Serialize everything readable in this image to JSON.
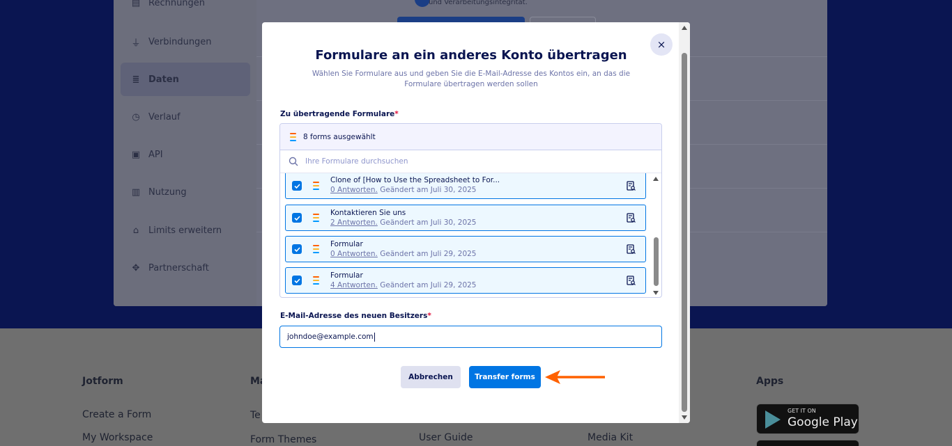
{
  "background": {
    "sidebar": {
      "items": [
        {
          "label": "Rechnungen",
          "icon": "invoice-icon",
          "active": false
        },
        {
          "label": "Verbindungen",
          "icon": "plug-icon",
          "active": false
        },
        {
          "label": "Daten",
          "icon": "database-icon",
          "active": true
        },
        {
          "label": "Verlauf",
          "icon": "history-icon",
          "active": false
        },
        {
          "label": "API",
          "icon": "api-icon",
          "active": false
        },
        {
          "label": "Nutzung",
          "icon": "bar-chart-icon",
          "active": false
        },
        {
          "label": "Limits erweitern",
          "icon": "gift-icon",
          "active": false
        },
        {
          "label": "Partnerschaft",
          "icon": "handshake-icon",
          "active": false
        }
      ]
    },
    "main": {
      "top_text": "und Verarbeitungsintegrität."
    },
    "footer": {
      "col1": {
        "heading": "Jotform",
        "links": [
          "Create a Form",
          "My Workspace"
        ]
      },
      "col2": {
        "heading": "Ma",
        "links": [
          "Te",
          "Form Themes"
        ]
      },
      "col3": {
        "links": [
          "User Guide"
        ]
      },
      "col4": {
        "links": [
          "Media Kit"
        ]
      },
      "apps": {
        "heading": "Apps",
        "badge_small": "GET IT ON",
        "badge_big": "Google Play"
      }
    }
  },
  "modal": {
    "title": "Formulare an ein anderes Konto übertragen",
    "subtitle": "Wählen Sie Formulare aus und geben Sie die E-Mail-Adresse des Kontos ein, an das die Formulare übertragen werden sollen",
    "forms_label": "Zu übertragende Formulare",
    "required_mark": "*",
    "selected_count": "8 forms ausgewählt",
    "search_placeholder": "Ihre Formulare durchsuchen",
    "forms": [
      {
        "title": "Clone of [How to Use the Spreadsheet to For...",
        "responses": "0 Antworten.",
        "modified": "Geändert am Juli 30, 2025",
        "checked": true
      },
      {
        "title": "Kontaktieren Sie uns",
        "responses": "2 Antworten.",
        "modified": "Geändert am Juli 30, 2025",
        "checked": true
      },
      {
        "title": "Formular",
        "responses": "0 Antworten.",
        "modified": "Geändert am Juli 29, 2025",
        "checked": true
      },
      {
        "title": "Formular",
        "responses": "4 Antworten.",
        "modified": "Geändert am Juli 29, 2025",
        "checked": true
      }
    ],
    "email_label": "E-Mail-Adresse des neuen Besitzers",
    "email_value": "johndoe@example.com",
    "cancel_label": "Abbrechen",
    "transfer_label": "Transfer forms",
    "close_icon": "×"
  },
  "colors": {
    "brand_navy": "#0a1551",
    "primary_blue": "#0075e3",
    "arrow_orange": "#ff6100",
    "required_red": "#e0103a"
  }
}
